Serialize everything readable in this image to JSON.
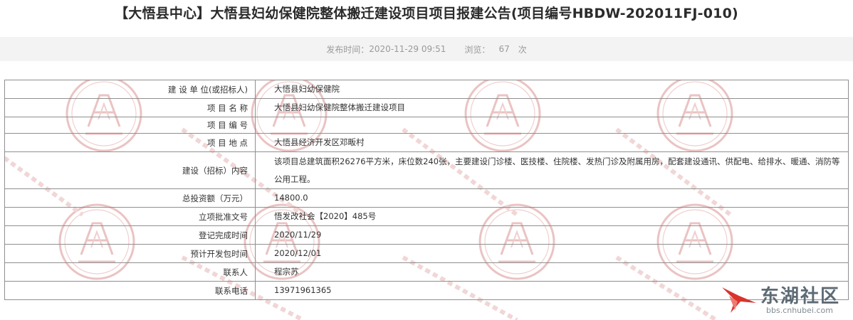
{
  "title": "【大悟县中心】大悟县妇幼保健院整体搬迁建设项目项目报建公告(项目编号HBDW-202011FJ-010)",
  "meta": {
    "publish_label": "发布时间：",
    "publish_time": "2020-11-29 09:51",
    "views_label": "浏览：",
    "views_count": "67",
    "views_unit": "次"
  },
  "rows": [
    {
      "label": "建 设 单 位(或招标人)",
      "value": "大悟县妇幼保健院"
    },
    {
      "label": "项 目 名 称",
      "value": "大悟县妇幼保健院整体搬迁建设项目"
    },
    {
      "label": "项 目 编 号",
      "value": ""
    },
    {
      "label": "项 目 地 点",
      "value": "大悟县经济开发区邓畈村"
    },
    {
      "label": "建设（招标）内容",
      "value": "该项目总建筑面积26276平方米，床位数240张，主要建设门诊楼、医技楼、住院楼、发热门诊及附属用房，配套建设通讯、供配电、给排水、暖通、消防等公用工程。"
    },
    {
      "label": "总投资额（万元）",
      "value": "14800.0"
    },
    {
      "label": "立项批准文号",
      "value": "悟发改社会【2020】485号"
    },
    {
      "label": "登记完成时间",
      "value": "2020/11/29"
    },
    {
      "label": "预计开发包时间",
      "value": "2020/12/01"
    },
    {
      "label": "联系人",
      "value": "程宗苏"
    },
    {
      "label": "联系电话",
      "value": "13971961365"
    }
  ],
  "logo": {
    "name": "东湖社区",
    "url": "bbs.cnhubei.com"
  },
  "colors": {
    "watermark": "#e9b8b8",
    "border": "#8f8f8f",
    "logo_red": "#d9332e"
  }
}
